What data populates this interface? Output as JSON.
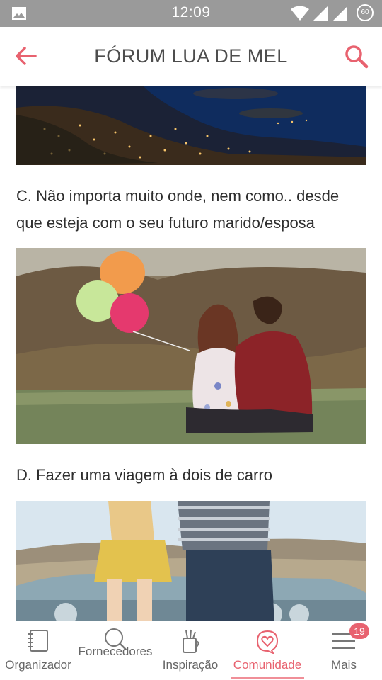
{
  "status_bar": {
    "time": "12:09",
    "battery": "60",
    "icons": [
      "gallery-icon",
      "wifi-icon",
      "signal-icon",
      "signal-icon",
      "battery-icon"
    ]
  },
  "app_bar": {
    "title": "FÓRUM LUA DE MEL",
    "accent_color": "#e8626f",
    "icons": {
      "back": "arrow-left-icon",
      "search": "search-icon"
    }
  },
  "content": {
    "option_c": "C. Não importa muito onde, nem como.. desde que esteja com o seu futuro marido/esposa",
    "option_d": "D. Fazer uma viagem à dois de carro",
    "images": [
      "city-lights-at-night-photo",
      "couple-kissing-with-balloons-photo",
      "couple-sitting-on-car-photo"
    ]
  },
  "bottom_nav": {
    "items": [
      {
        "label": "Organizador",
        "icon": "notebook-icon"
      },
      {
        "label": "Fornecedores",
        "icon": "search-icon"
      },
      {
        "label": "Inspiração",
        "icon": "brushes-jar-icon"
      },
      {
        "label": "Comunidade",
        "icon": "heart-chat-icon",
        "active": true
      },
      {
        "label": "Mais",
        "icon": "menu-icon"
      }
    ],
    "badge": "19",
    "active_color": "#e8626f"
  }
}
